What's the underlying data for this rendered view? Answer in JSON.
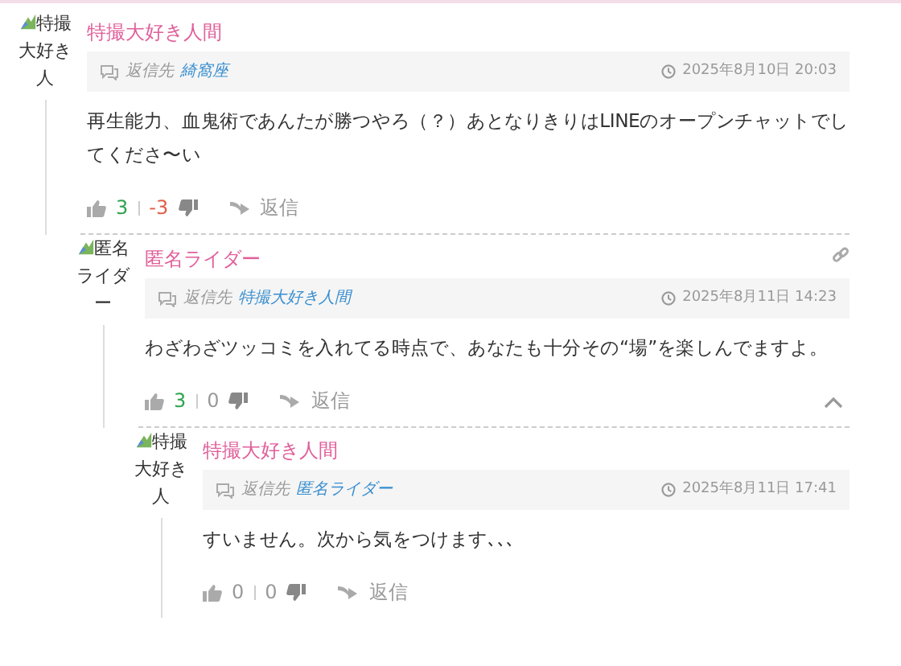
{
  "comments": [
    {
      "author": "特撮大好き人間",
      "avatar_alt": "特撮大好き人",
      "reply_label": "返信先",
      "reply_to": "綺窩座",
      "date": "2025年8月10日 20:03",
      "body": "再生能力、血鬼術であんたが勝つやろ（？）あとなりきりはLINEのオープンチャットでしてくださ〜い",
      "likes": "3",
      "dislikes": "-3",
      "reply_button": "返信",
      "permalink": false,
      "collapse": false,
      "children": [
        {
          "author": "匿名ライダー",
          "avatar_alt": "匿名ライダー",
          "reply_label": "返信先",
          "reply_to": "特撮大好き人間",
          "date": "2025年8月11日 14:23",
          "body": "わざわざツッコミを入れてる時点で、あなたも十分その“場”を楽しんでますよ。",
          "likes": "3",
          "dislikes": "0",
          "reply_button": "返信",
          "permalink": true,
          "collapse": true,
          "children": [
            {
              "author": "特撮大好き人間",
              "avatar_alt": "特撮大好き人",
              "reply_label": "返信先",
              "reply_to": "匿名ライダー",
              "date": "2025年8月11日 17:41",
              "body": "すいません。次から気をつけます､､､",
              "likes": "0",
              "dislikes": "0",
              "reply_button": "返信",
              "permalink": false,
              "collapse": false
            }
          ]
        }
      ]
    }
  ]
}
